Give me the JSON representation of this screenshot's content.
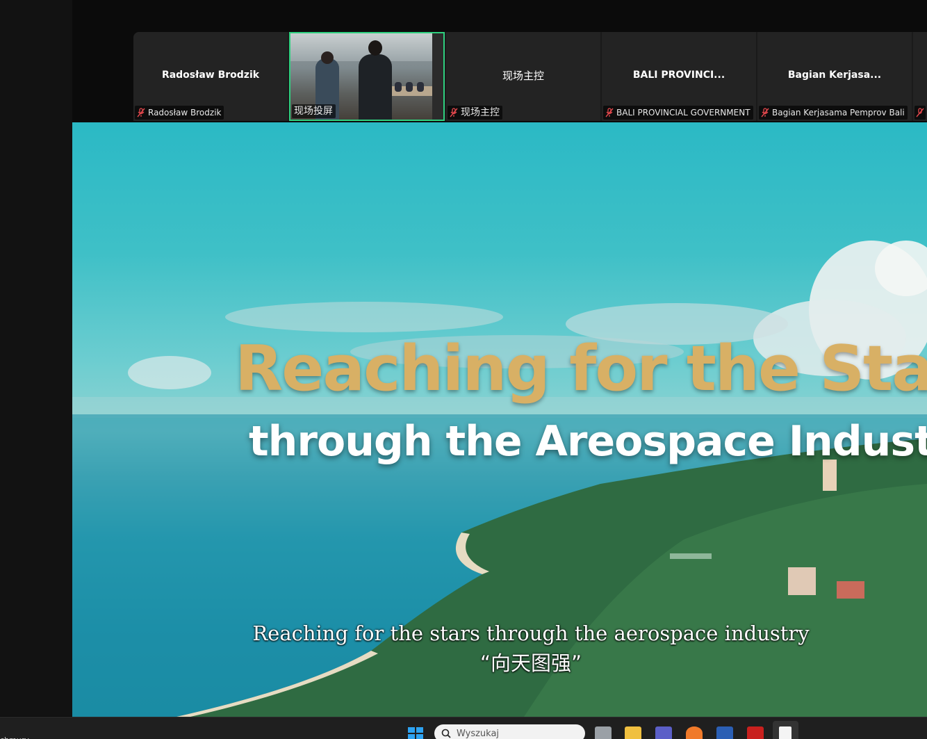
{
  "participants": [
    {
      "tile_name": "Radosław Brodzik",
      "label": "Radosław Brodzik",
      "muted": true,
      "has_video": false
    },
    {
      "tile_name": "",
      "label": "现场投屏",
      "muted": false,
      "has_video": true,
      "speaking": true
    },
    {
      "tile_name": "现场主控",
      "label": "现场主控",
      "muted": true,
      "has_video": false
    },
    {
      "tile_name": "BALI  PROVINCI...",
      "label": "BALI PROVINCIAL GOVERNMENT",
      "muted": true,
      "has_video": false
    },
    {
      "tile_name": "Bagian  Kerjasa...",
      "label": "Bagian Kerjasama Pemprov Bali",
      "muted": true,
      "has_video": false
    }
  ],
  "shared_screen": {
    "headline": "Reaching for the Stars",
    "subheadline": "through the Areospace Industry",
    "caption_en": "Reaching for the stars through the aerospace industry",
    "caption_cn": "“向天图强”"
  },
  "taskbar": {
    "left_text": "chmury",
    "search_placeholder": "Wyszukaj"
  },
  "colors": {
    "speaker_border": "#2fd07f",
    "muted_mic": "#e5484d",
    "headline_gold": "#d8b065"
  }
}
